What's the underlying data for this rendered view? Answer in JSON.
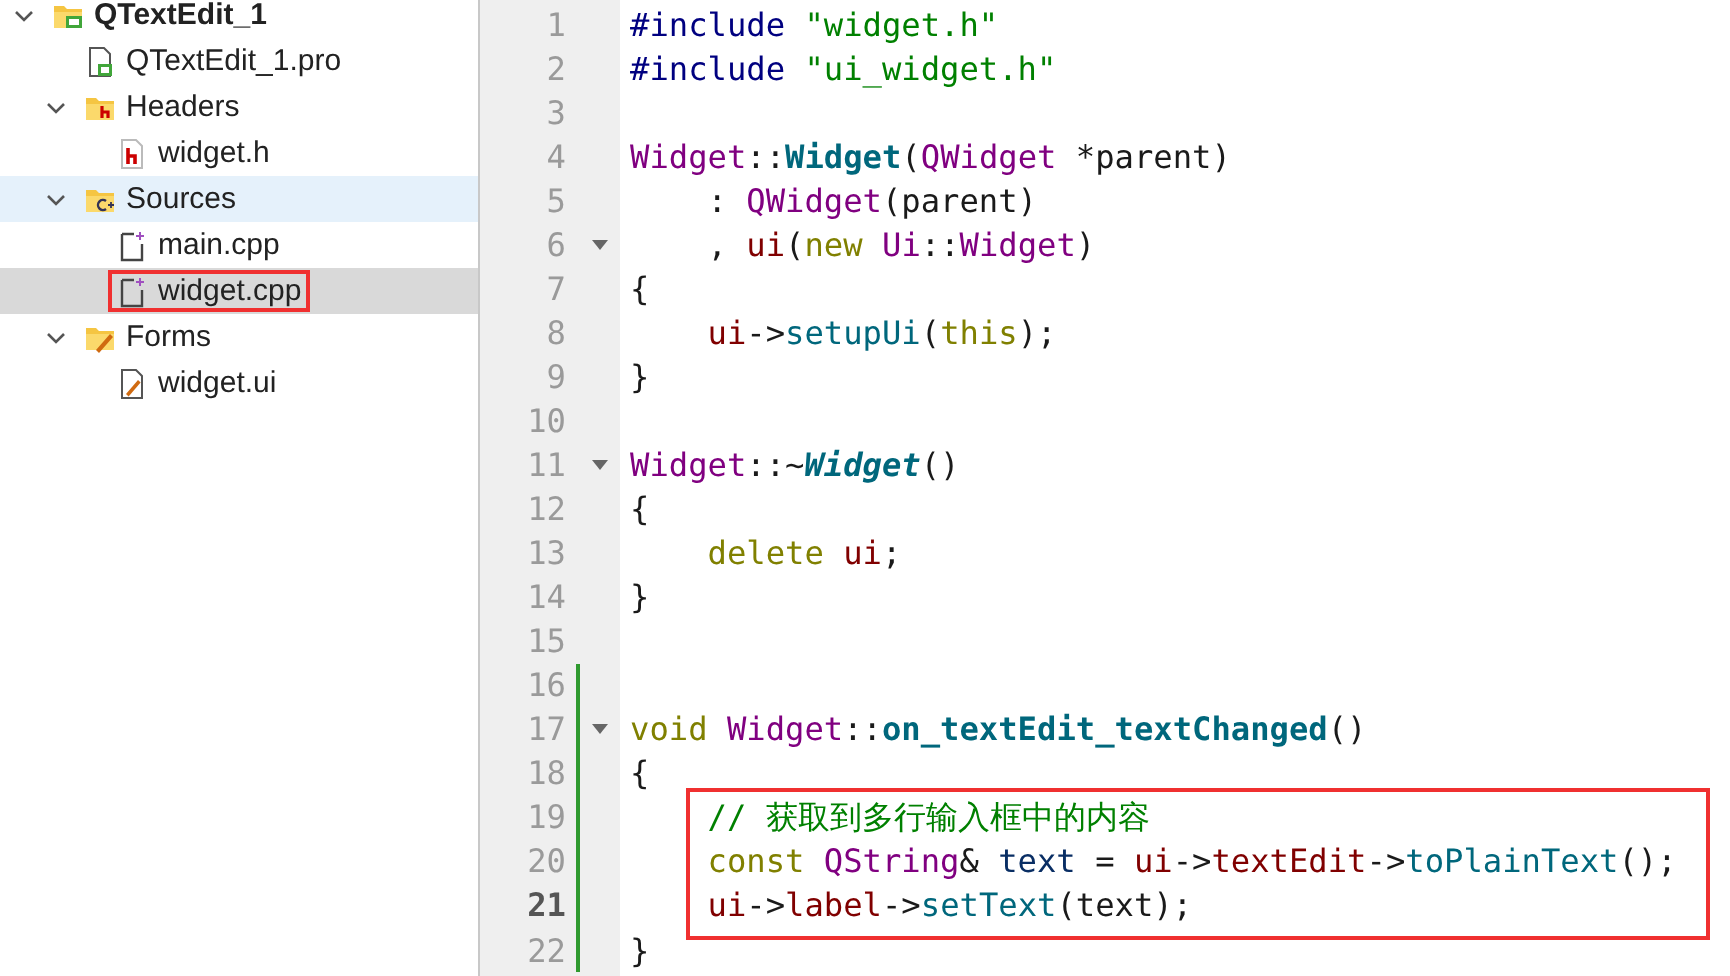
{
  "project_tree": [
    {
      "label": "QTextEdit_1",
      "kind": "project",
      "expanded": true,
      "selected": false,
      "current": false,
      "boxed": false,
      "children": [
        {
          "label": "QTextEdit_1.pro",
          "kind": "pro-file",
          "selected": false,
          "current": false,
          "boxed": false
        },
        {
          "label": "Headers",
          "kind": "header-folder",
          "expanded": true,
          "selected": false,
          "current": false,
          "boxed": false,
          "children": [
            {
              "label": "widget.h",
              "kind": "header-file",
              "selected": false,
              "current": false,
              "boxed": false
            }
          ]
        },
        {
          "label": "Sources",
          "kind": "source-folder",
          "expanded": true,
          "selected": true,
          "current": false,
          "boxed": false,
          "children": [
            {
              "label": "main.cpp",
              "kind": "source-file",
              "selected": false,
              "current": false,
              "boxed": false
            },
            {
              "label": "widget.cpp",
              "kind": "source-file",
              "selected": false,
              "current": true,
              "boxed": true
            }
          ]
        },
        {
          "label": "Forms",
          "kind": "form-folder",
          "expanded": true,
          "selected": false,
          "current": false,
          "boxed": false,
          "children": [
            {
              "label": "widget.ui",
              "kind": "form-file",
              "selected": false,
              "current": false,
              "boxed": false
            }
          ]
        }
      ]
    }
  ],
  "editor": {
    "lines": [
      {
        "number": "1",
        "indented": false,
        "foldable": false,
        "changed": false,
        "current": false,
        "boxed": false,
        "tokens": [
          {
            "kind": "pre",
            "text": "#include "
          },
          {
            "kind": "str",
            "text": "\"widget.h\""
          }
        ]
      },
      {
        "number": "2",
        "indented": false,
        "foldable": false,
        "changed": false,
        "current": false,
        "boxed": false,
        "tokens": [
          {
            "kind": "pre",
            "text": "#include "
          },
          {
            "kind": "str",
            "text": "\"ui_widget.h\""
          }
        ]
      },
      {
        "number": "3",
        "indented": false,
        "foldable": false,
        "changed": false,
        "current": false,
        "boxed": false
      },
      {
        "number": "4",
        "indented": false,
        "foldable": false,
        "changed": false,
        "current": false,
        "boxed": false,
        "tokens": [
          {
            "kind": "type",
            "text": "Widget"
          },
          {
            "kind": "plain",
            "text": "::"
          },
          {
            "kind": "fnbold",
            "text": "Widget"
          },
          {
            "kind": "plain",
            "text": "("
          },
          {
            "kind": "type",
            "text": "QWidget"
          },
          {
            "kind": "plain",
            "text": " *parent)"
          }
        ]
      },
      {
        "number": "5",
        "indented": true,
        "foldable": false,
        "changed": false,
        "current": false,
        "boxed": false,
        "tokens": [
          {
            "kind": "plain",
            "text": ": "
          },
          {
            "kind": "type",
            "text": "QWidget"
          },
          {
            "kind": "plain",
            "text": "(parent)"
          }
        ]
      },
      {
        "number": "6",
        "indented": true,
        "foldable": true,
        "changed": false,
        "current": false,
        "boxed": false,
        "tokens": [
          {
            "kind": "plain",
            "text": ", "
          },
          {
            "kind": "member",
            "text": "ui"
          },
          {
            "kind": "plain",
            "text": "("
          },
          {
            "kind": "kw",
            "text": "new "
          },
          {
            "kind": "type",
            "text": "Ui"
          },
          {
            "kind": "plain",
            "text": "::"
          },
          {
            "kind": "type",
            "text": "Widget"
          },
          {
            "kind": "plain",
            "text": ")"
          }
        ]
      },
      {
        "number": "7",
        "indented": false,
        "foldable": false,
        "changed": false,
        "current": false,
        "boxed": false,
        "tokens": [
          {
            "kind": "plain",
            "text": "{"
          }
        ]
      },
      {
        "number": "8",
        "indented": true,
        "foldable": false,
        "changed": false,
        "current": false,
        "boxed": false,
        "tokens": [
          {
            "kind": "member",
            "text": "ui"
          },
          {
            "kind": "plain",
            "text": "->"
          },
          {
            "kind": "fn",
            "text": "setupUi"
          },
          {
            "kind": "plain",
            "text": "("
          },
          {
            "kind": "kw",
            "text": "this"
          },
          {
            "kind": "plain",
            "text": ");"
          }
        ]
      },
      {
        "number": "9",
        "indented": false,
        "foldable": false,
        "changed": false,
        "current": false,
        "boxed": false,
        "tokens": [
          {
            "kind": "plain",
            "text": "}"
          }
        ]
      },
      {
        "number": "10",
        "indented": false,
        "foldable": false,
        "changed": false,
        "current": false,
        "boxed": false
      },
      {
        "number": "11",
        "indented": false,
        "foldable": true,
        "changed": false,
        "current": false,
        "boxed": false,
        "tokens": [
          {
            "kind": "type",
            "text": "Widget"
          },
          {
            "kind": "plain",
            "text": "::~"
          },
          {
            "kind": "fnitalic",
            "text": "Widget"
          },
          {
            "kind": "plain",
            "text": "()"
          }
        ]
      },
      {
        "number": "12",
        "indented": false,
        "foldable": false,
        "changed": false,
        "current": false,
        "boxed": false,
        "tokens": [
          {
            "kind": "plain",
            "text": "{"
          }
        ]
      },
      {
        "number": "13",
        "indented": true,
        "foldable": false,
        "changed": false,
        "current": false,
        "boxed": false,
        "tokens": [
          {
            "kind": "kw",
            "text": "delete "
          },
          {
            "kind": "member",
            "text": "ui"
          },
          {
            "kind": "plain",
            "text": ";"
          }
        ]
      },
      {
        "number": "14",
        "indented": false,
        "foldable": false,
        "changed": false,
        "current": false,
        "boxed": false,
        "tokens": [
          {
            "kind": "plain",
            "text": "}"
          }
        ]
      },
      {
        "number": "15",
        "indented": false,
        "foldable": false,
        "changed": false,
        "current": false,
        "boxed": false
      },
      {
        "number": "16",
        "indented": false,
        "foldable": false,
        "changed": true,
        "current": false,
        "boxed": false
      },
      {
        "number": "17",
        "indented": false,
        "foldable": true,
        "changed": true,
        "current": false,
        "boxed": false,
        "tokens": [
          {
            "kind": "kw",
            "text": "void "
          },
          {
            "kind": "type",
            "text": "Widget"
          },
          {
            "kind": "plain",
            "text": "::"
          },
          {
            "kind": "fnbold",
            "text": "on_textEdit_textChanged"
          },
          {
            "kind": "plain",
            "text": "()"
          }
        ]
      },
      {
        "number": "18",
        "indented": false,
        "foldable": false,
        "changed": true,
        "current": false,
        "boxed": false,
        "tokens": [
          {
            "kind": "plain",
            "text": "{"
          }
        ]
      },
      {
        "number": "19",
        "indented": true,
        "foldable": false,
        "changed": true,
        "current": false,
        "boxed": true,
        "tokens": [
          {
            "kind": "comment",
            "text": "// 获取到多行输入框中的内容"
          }
        ]
      },
      {
        "number": "20",
        "indented": true,
        "foldable": false,
        "changed": true,
        "current": false,
        "boxed": true,
        "tokens": [
          {
            "kind": "kw",
            "text": "const "
          },
          {
            "kind": "type",
            "text": "QString"
          },
          {
            "kind": "plain",
            "text": "& "
          },
          {
            "kind": "var",
            "text": "text"
          },
          {
            "kind": "plain",
            "text": " = "
          },
          {
            "kind": "member",
            "text": "ui"
          },
          {
            "kind": "plain",
            "text": "->"
          },
          {
            "kind": "member",
            "text": "textEdit"
          },
          {
            "kind": "plain",
            "text": "->"
          },
          {
            "kind": "fn",
            "text": "toPlainText"
          },
          {
            "kind": "plain",
            "text": "();"
          }
        ]
      },
      {
        "number": "21",
        "indented": true,
        "foldable": false,
        "changed": true,
        "current": true,
        "boxed": true,
        "tokens": [
          {
            "kind": "member",
            "text": "ui"
          },
          {
            "kind": "plain",
            "text": "->"
          },
          {
            "kind": "member",
            "text": "label"
          },
          {
            "kind": "plain",
            "text": "->"
          },
          {
            "kind": "fn",
            "text": "setText"
          },
          {
            "kind": "plain",
            "text": "(text);"
          }
        ]
      },
      {
        "number": "22",
        "indented": false,
        "foldable": false,
        "changed": true,
        "current": false,
        "boxed": false,
        "tokens": [
          {
            "kind": "plain",
            "text": "}"
          }
        ]
      }
    ]
  }
}
